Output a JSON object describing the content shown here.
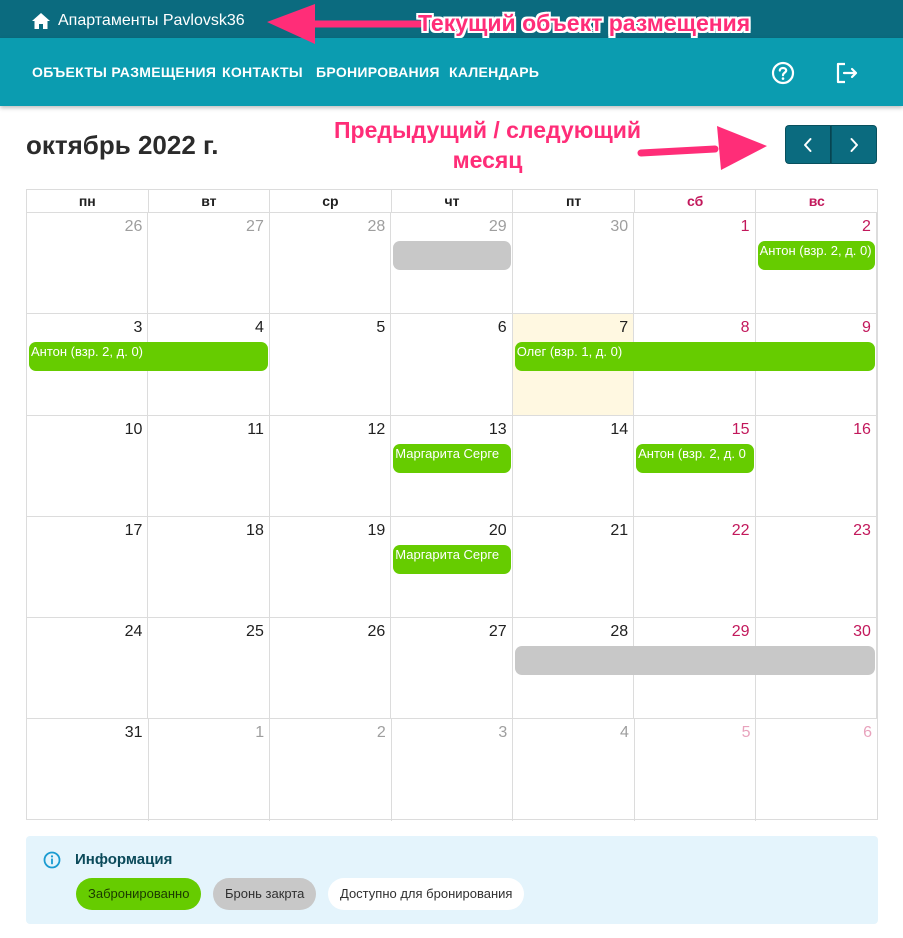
{
  "topbar": {
    "title": "Апартаменты Pavlovsk36",
    "home_icon": "home-icon"
  },
  "nav": {
    "items": [
      "ОБЪЕКТЫ РАЗМЕЩЕНИЯ",
      "КОНТАКТЫ",
      "БРОНИРОВАНИЯ",
      "КАЛЕНДАРЬ"
    ],
    "help_icon": "help-circle-icon",
    "logout_icon": "logout-icon"
  },
  "annotations": {
    "current_object": "Текущий объект размещения",
    "prev_next_line1": "Предыдущий / следующий",
    "prev_next_line2": "месяц"
  },
  "calendar": {
    "month_title": "октябрь 2022 г.",
    "prev_icon": "chevron-left-icon",
    "next_icon": "chevron-right-icon",
    "weekdays": [
      "пн",
      "вт",
      "ср",
      "чт",
      "пт",
      "сб",
      "вс"
    ],
    "weeks": [
      [
        "26",
        "27",
        "28",
        "29",
        "30",
        "1",
        "2"
      ],
      [
        "3",
        "4",
        "5",
        "6",
        "7",
        "8",
        "9"
      ],
      [
        "10",
        "11",
        "12",
        "13",
        "14",
        "15",
        "16"
      ],
      [
        "17",
        "18",
        "19",
        "20",
        "21",
        "22",
        "23"
      ],
      [
        "24",
        "25",
        "26",
        "27",
        "28",
        "29",
        "30"
      ],
      [
        "31",
        "1",
        "2",
        "3",
        "4",
        "5",
        "6"
      ]
    ],
    "events": [
      {
        "week": 0,
        "start": 3,
        "span": 1,
        "type": "closed",
        "label": ""
      },
      {
        "week": 0,
        "start": 6,
        "span": 1,
        "type": "booked",
        "label": "Антон (взр. 2, д. 0)"
      },
      {
        "week": 1,
        "start": 0,
        "span": 2,
        "type": "booked",
        "label": "Антон (взр. 2, д. 0)"
      },
      {
        "week": 1,
        "start": 4,
        "span": 3,
        "type": "booked",
        "label": "Олег (взр. 1, д. 0)"
      },
      {
        "week": 2,
        "start": 3,
        "span": 1,
        "type": "booked",
        "label": "Маргарита Серге"
      },
      {
        "week": 2,
        "start": 5,
        "span": 1,
        "type": "booked",
        "label": "Антон (взр. 2, д. 0"
      },
      {
        "week": 3,
        "start": 3,
        "span": 1,
        "type": "booked",
        "label": "Маргарита Серге"
      },
      {
        "week": 4,
        "start": 4,
        "span": 3,
        "type": "closed",
        "label": ""
      }
    ]
  },
  "info": {
    "title": "Информация",
    "info_icon": "info-icon",
    "legend": [
      "Забронированно",
      "Бронь закрта",
      "Доступно для бронирования"
    ]
  },
  "colors": {
    "topbar": "#0b6b7f",
    "navbar": "#0b9cb0",
    "booked": "#66cc00",
    "closed": "#c8c8c8",
    "weekend": "#c2185b",
    "today": "#fff8e1",
    "annotation": "#ff2d78"
  }
}
